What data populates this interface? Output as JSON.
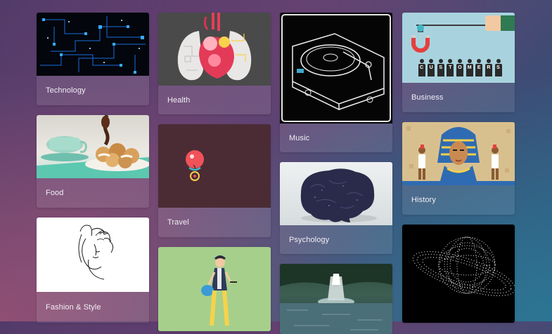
{
  "categories": [
    {
      "label": "Technology",
      "thumb": "circuit-board-image"
    },
    {
      "label": "Food",
      "thumb": "cream-puffs-image"
    },
    {
      "label": "Fashion & Style",
      "thumb": "woman-sketch-image"
    },
    {
      "label": "Health",
      "thumb": "lungs-heart-image"
    },
    {
      "label": "Travel",
      "thumb": "red-balloon-image"
    },
    {
      "label": "",
      "thumb": "walking-man-image"
    },
    {
      "label": "Music",
      "thumb": "turntable-image"
    },
    {
      "label": "Psychology",
      "thumb": "brain-image"
    },
    {
      "label": "",
      "thumb": "waterfall-image"
    },
    {
      "label": "Business",
      "thumb": "magnet-customers-image"
    },
    {
      "label": "History",
      "thumb": "pharaoh-image"
    },
    {
      "label": "",
      "thumb": "particle-planet-image"
    }
  ],
  "business_letters": [
    "C",
    "U",
    "S",
    "T",
    "O",
    "M",
    "E",
    "R",
    "S"
  ],
  "colors": {
    "caption_text": "#f2eef5",
    "health_bg": "#4a4a4a",
    "travel_bg": "#4b2c35",
    "business_bg": "#a8d3de",
    "fashion_bg": "#ffffff",
    "walking_bg": "#a6cf8c",
    "history_bg": "#d8c08e"
  }
}
